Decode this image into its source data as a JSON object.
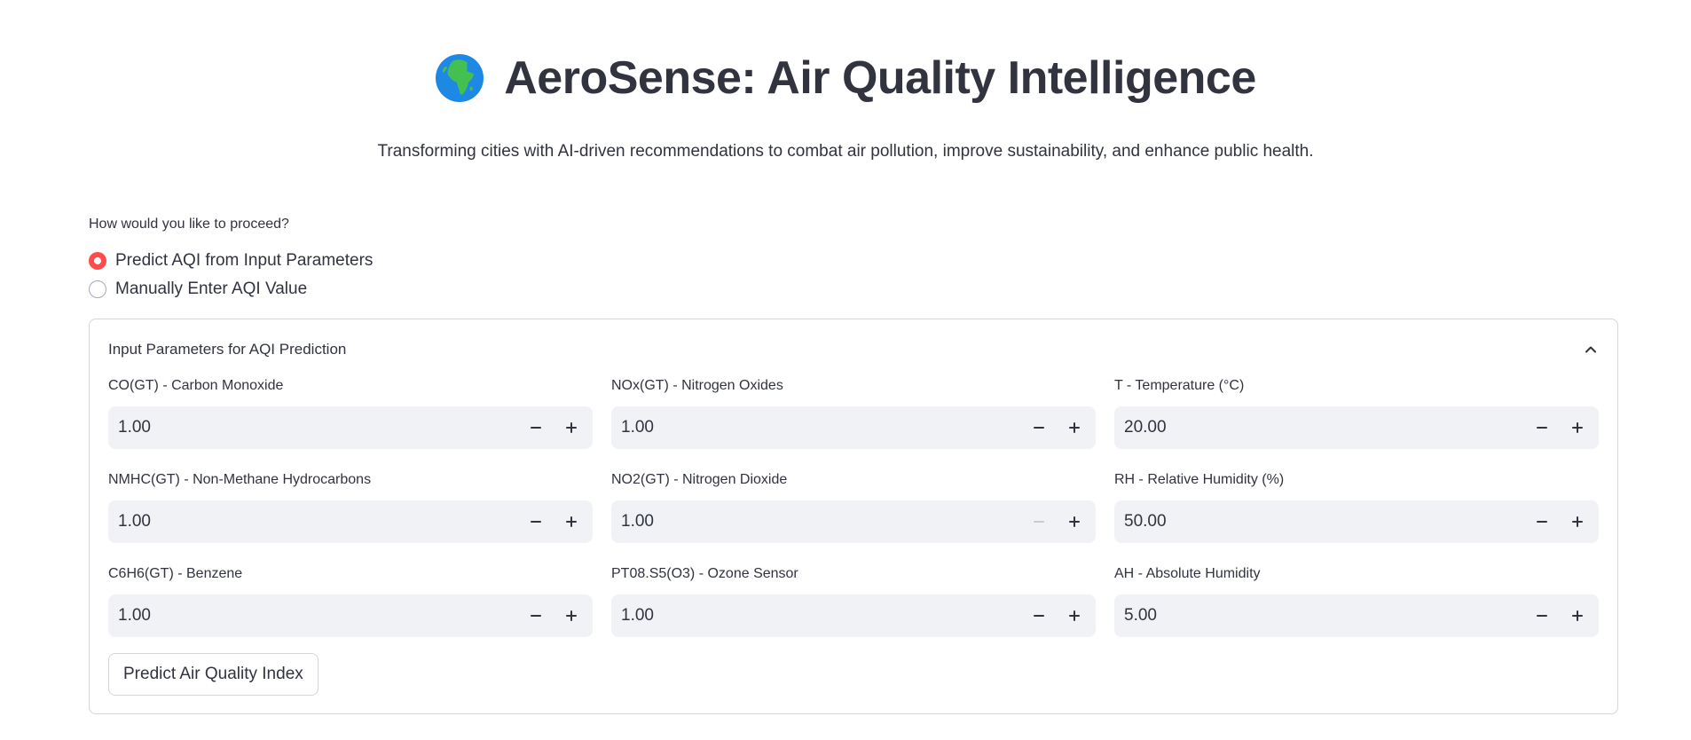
{
  "header": {
    "icon": "globe-africa-icon",
    "title": "AeroSense: Air Quality Intelligence",
    "subtitle": "Transforming cities with AI-driven recommendations to combat air pollution, improve sustainability, and enhance public health."
  },
  "mode": {
    "label": "How would you like to proceed?",
    "options": [
      {
        "label": "Predict AQI from Input Parameters",
        "selected": true
      },
      {
        "label": "Manually Enter AQI Value",
        "selected": false
      }
    ]
  },
  "colors": {
    "accent": "#ff4b4b",
    "input_bg": "#f0f2f6",
    "text": "#31333f"
  },
  "panel": {
    "title": "Input Parameters for AQI Prediction",
    "expanded": true,
    "fields": [
      {
        "label": "CO(GT) - Carbon Monoxide",
        "value": "1.00"
      },
      {
        "label": "NOx(GT) - Nitrogen Oxides",
        "value": "1.00"
      },
      {
        "label": "T - Temperature (°C)",
        "value": "20.00"
      },
      {
        "label": "NMHC(GT) - Non-Methane Hydrocarbons",
        "value": "1.00"
      },
      {
        "label": "NO2(GT) - Nitrogen Dioxide",
        "value": "1.00",
        "decrement_disabled": true
      },
      {
        "label": "RH - Relative Humidity (%)",
        "value": "50.00"
      },
      {
        "label": "C6H6(GT) - Benzene",
        "value": "1.00"
      },
      {
        "label": "PT08.S5(O3) - Ozone Sensor",
        "value": "1.00"
      },
      {
        "label": "AH - Absolute Humidity",
        "value": "5.00"
      }
    ],
    "button_label": "Predict Air Quality Index"
  }
}
